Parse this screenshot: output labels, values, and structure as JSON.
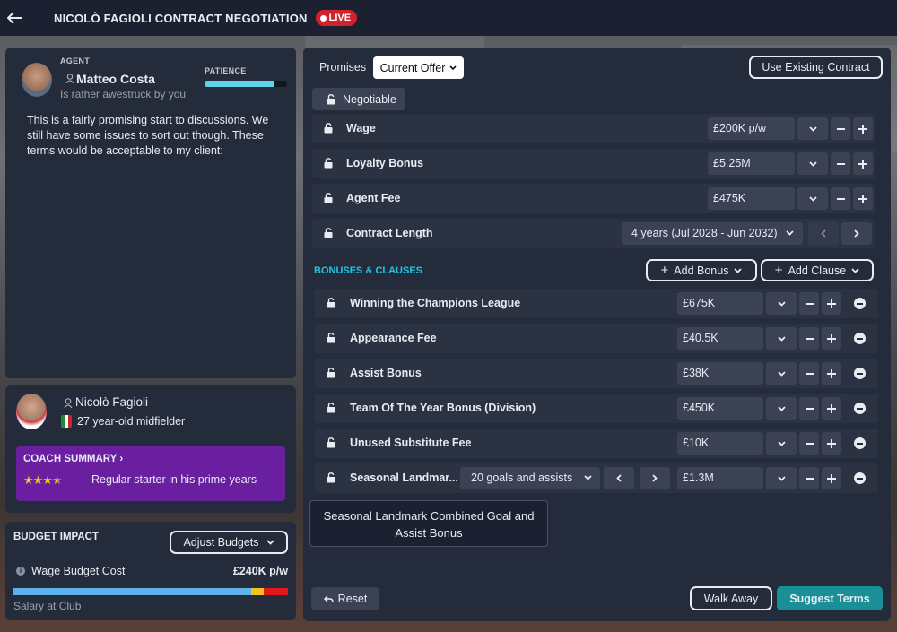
{
  "header": {
    "title": "NICOLÒ FAGIOLI CONTRACT NEGOTIATION",
    "live": "LIVE"
  },
  "agent": {
    "role": "AGENT",
    "name": "Matteo Costa",
    "mood": "Is rather awestruck by you",
    "patience_label": "PATIENCE",
    "patience_level": 0.78,
    "message": "This is a fairly promising start to discussions. We still have some issues to sort out though. These terms would be acceptable to my client:"
  },
  "player": {
    "name": "Nicolò Fagioli",
    "desc": "27 year-old midfielder",
    "coach_title": "COACH SUMMARY",
    "coach_text": "Regular starter in his prime years",
    "stars": 3.5
  },
  "budget": {
    "title": "BUDGET IMPACT",
    "adjust": "Adjust Budgets",
    "cost_label": "Wage Budget Cost",
    "cost_value": "£240K p/w",
    "salary_label": "Salary at Club"
  },
  "offer": {
    "promises": "Promises",
    "dropdown": "Current Offer",
    "existing": "Use Existing Contract",
    "negotiable": "Negotiable",
    "terms": [
      {
        "label": "Wage",
        "value": "£200K p/w"
      },
      {
        "label": "Loyalty Bonus",
        "value": "£5.25M"
      },
      {
        "label": "Agent Fee",
        "value": "£475K"
      }
    ],
    "contract_label": "Contract Length",
    "contract_value": "4 years (Jul 2028 - Jun 2032)",
    "bonuses_title": "BONUSES & CLAUSES",
    "add_bonus": "Add Bonus",
    "add_clause": "Add Clause",
    "bonuses": [
      {
        "label": "Winning the Champions League",
        "value": "£675K"
      },
      {
        "label": "Appearance Fee",
        "value": "£40.5K"
      },
      {
        "label": "Assist Bonus",
        "value": "£38K"
      },
      {
        "label": "Team Of The Year Bonus (Division)",
        "value": "£450K"
      },
      {
        "label": "Unused Substitute Fee",
        "value": "£10K"
      },
      {
        "label": "Seasonal Landmar...",
        "value": "£1.3M",
        "condition": "20 goals and assists"
      }
    ],
    "tooltip": "Seasonal Landmark Combined Goal and Assist Bonus",
    "reset": "Reset",
    "walk_away": "Walk Away",
    "suggest": "Suggest Terms"
  },
  "colors": {
    "accent": "#1ec8e6",
    "live": "#d4202a",
    "suggest": "#1a8f97",
    "coach": "#6a1fa0"
  }
}
